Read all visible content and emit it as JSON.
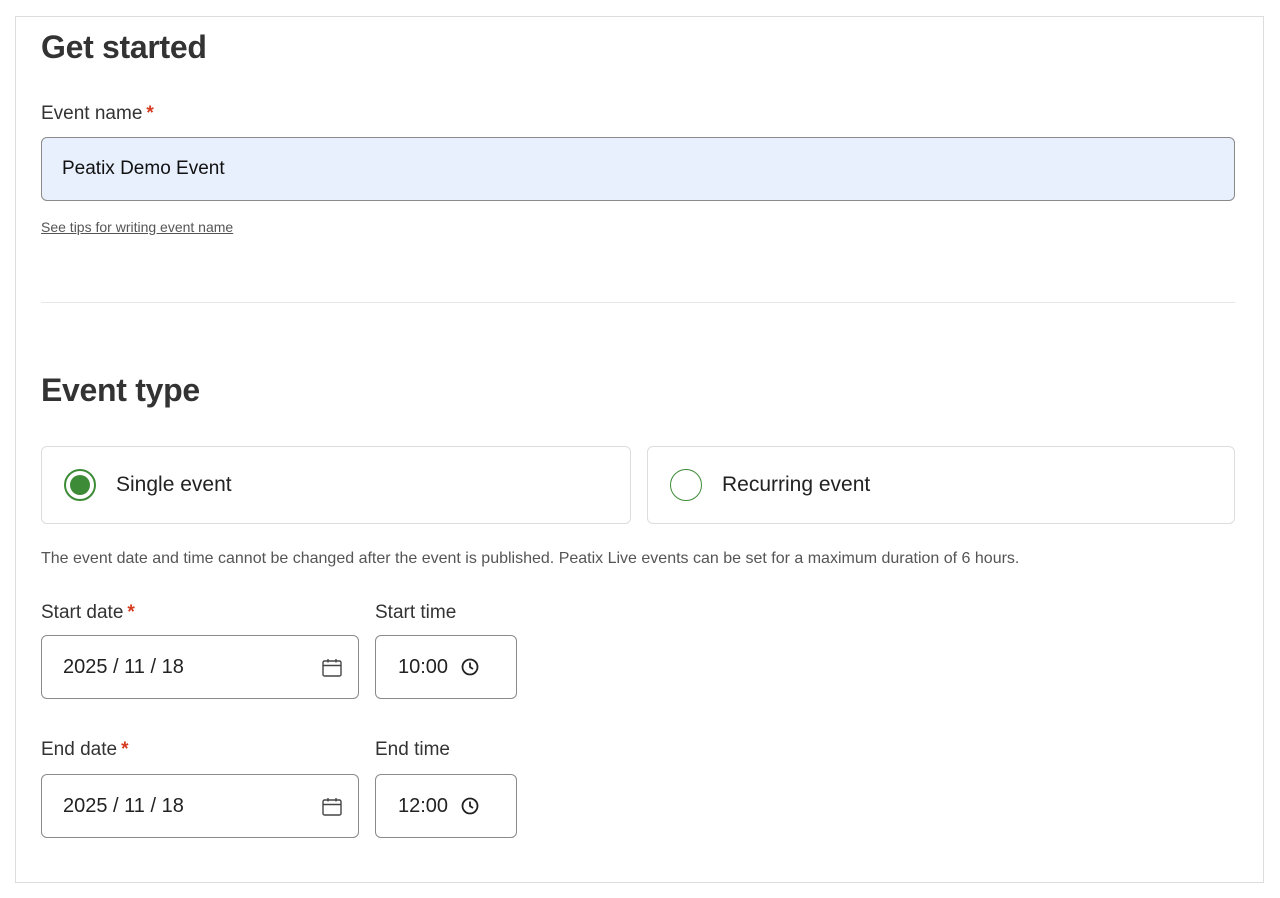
{
  "get_started": {
    "title": "Get started",
    "event_name_label": "Event name",
    "required_mark": "*",
    "event_name_value": "Peatix Demo Event",
    "tips_link": "See tips for writing event name"
  },
  "event_type": {
    "title": "Event type",
    "options": [
      {
        "label": "Single event",
        "selected": true
      },
      {
        "label": "Recurring event",
        "selected": false
      }
    ],
    "notice": "The event date and time cannot be changed after the event is published. Peatix Live events can be set for a maximum duration of 6 hours.",
    "start_date_label": "Start date",
    "start_time_label": "Start time",
    "start_date_value": "2025 / 11 / 18",
    "start_time_value": "10:00",
    "end_date_label": "End date",
    "end_time_label": "End time",
    "end_date_value": "2025 / 11 / 18",
    "end_time_value": "12:00"
  },
  "colors": {
    "accent_green": "#3d8b37",
    "required_red": "#d63a1f",
    "autofill_blue": "#e8f0fe"
  },
  "icons": {
    "date": "calendar-icon",
    "time": "clock-icon"
  }
}
